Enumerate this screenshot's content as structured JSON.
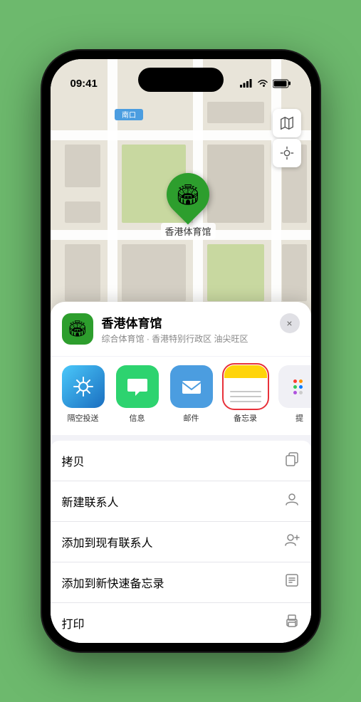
{
  "statusBar": {
    "time": "09:41",
    "signal": "●●●●",
    "wifi": "wifi",
    "battery": "battery"
  },
  "map": {
    "locationLabel": "南口",
    "venueName": "香港体育馆",
    "controls": {
      "mapTypeIcon": "map",
      "locationIcon": "location"
    }
  },
  "venueCard": {
    "icon": "🏟",
    "title": "香港体育馆",
    "subtitle": "综合体育馆 · 香港特别行政区 油尖旺区",
    "closeLabel": "×"
  },
  "shareRow": {
    "items": [
      {
        "id": "airdrop",
        "label": "隔空投送",
        "type": "airdrop"
      },
      {
        "id": "message",
        "label": "信息",
        "type": "message"
      },
      {
        "id": "mail",
        "label": "邮件",
        "type": "mail"
      },
      {
        "id": "notes",
        "label": "备忘录",
        "type": "notes"
      },
      {
        "id": "more",
        "label": "提",
        "type": "more"
      }
    ]
  },
  "menuItems": [
    {
      "id": "copy",
      "label": "拷贝",
      "icon": "📋"
    },
    {
      "id": "new-contact",
      "label": "新建联系人",
      "icon": "👤"
    },
    {
      "id": "add-contact",
      "label": "添加到现有联系人",
      "icon": "👤+"
    },
    {
      "id": "quick-note",
      "label": "添加到新快速备忘录",
      "icon": "📝"
    },
    {
      "id": "print",
      "label": "打印",
      "icon": "🖨"
    }
  ]
}
